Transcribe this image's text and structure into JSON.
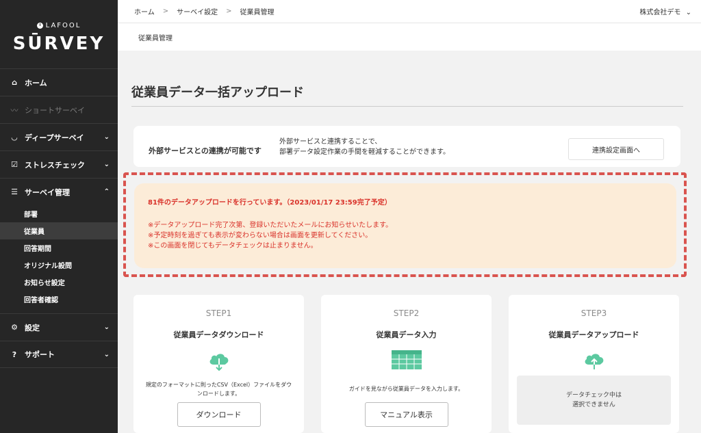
{
  "brand": {
    "top": "LAFOOL",
    "main": "SŪRVEY"
  },
  "sidebar": {
    "items": [
      {
        "icon": "⌂",
        "label": "ホーム"
      },
      {
        "icon": "〰",
        "label": "ショートサーベイ"
      },
      {
        "icon": "◡",
        "label": "ディープサーベイ",
        "chev": "⌄"
      },
      {
        "icon": "☑",
        "label": "ストレスチェック",
        "chev": "⌄"
      },
      {
        "icon": "☰",
        "label": "サーベイ管理",
        "chev": "⌃"
      },
      {
        "icon": "⚙",
        "label": "設定",
        "chev": "⌄"
      },
      {
        "icon": "?",
        "label": "サポート",
        "chev": "⌄"
      }
    ],
    "sub_items": [
      "部署",
      "従業員",
      "回答期間",
      "オリジナル設問",
      "お知らせ設定",
      "回答者確認"
    ]
  },
  "breadcrumb": {
    "home": "ホーム",
    "survey_settings": "サーベイ設定",
    "current": "従業員管理",
    "sep": ">"
  },
  "company": {
    "name": "株式会社デモ",
    "chev": "⌄"
  },
  "subheader": "従業員管理",
  "page_title": "従業員データ一括アップロード",
  "integration": {
    "heading": "外部サービスとの連携が可能です",
    "desc_line1": "外部サービスと連携することで、",
    "desc_line2": "部署データ設定作業の手間を軽減することができます。",
    "button": "連携設定画面へ"
  },
  "notice": {
    "heading": "81件のデータアップロードを行っています。（2023/01/17 23:59完了予定）",
    "line1": "※データアップロード完了次第、登録いただいたメールにお知らせいたします。",
    "line2": "※予定時刻を過ぎても表示が変わらない場合は画面を更新してください。",
    "line3": "※この画面を閉じてもデータチェックは止まりません。"
  },
  "steps": [
    {
      "label": "STEP1",
      "title": "従業員データダウンロード",
      "desc_line1": "規定のフォーマットに則ったCSV（Excel）ファイルをダウ",
      "desc_line2": "ンロードします。",
      "button": "ダウンロード"
    },
    {
      "label": "STEP2",
      "title": "従業員データ入力",
      "desc": "ガイドを見ながら従業員データを入力します。",
      "button": "マニュアル表示"
    },
    {
      "label": "STEP3",
      "title": "従業員データアップロード",
      "disabled_line1": "データチェック中は",
      "disabled_line2": "選択できません"
    }
  ],
  "colors": {
    "accent_green": "#5cc9a0",
    "notice_red": "#d9322a",
    "notice_bg": "#fcecd8",
    "sidebar_bg": "#262626"
  }
}
